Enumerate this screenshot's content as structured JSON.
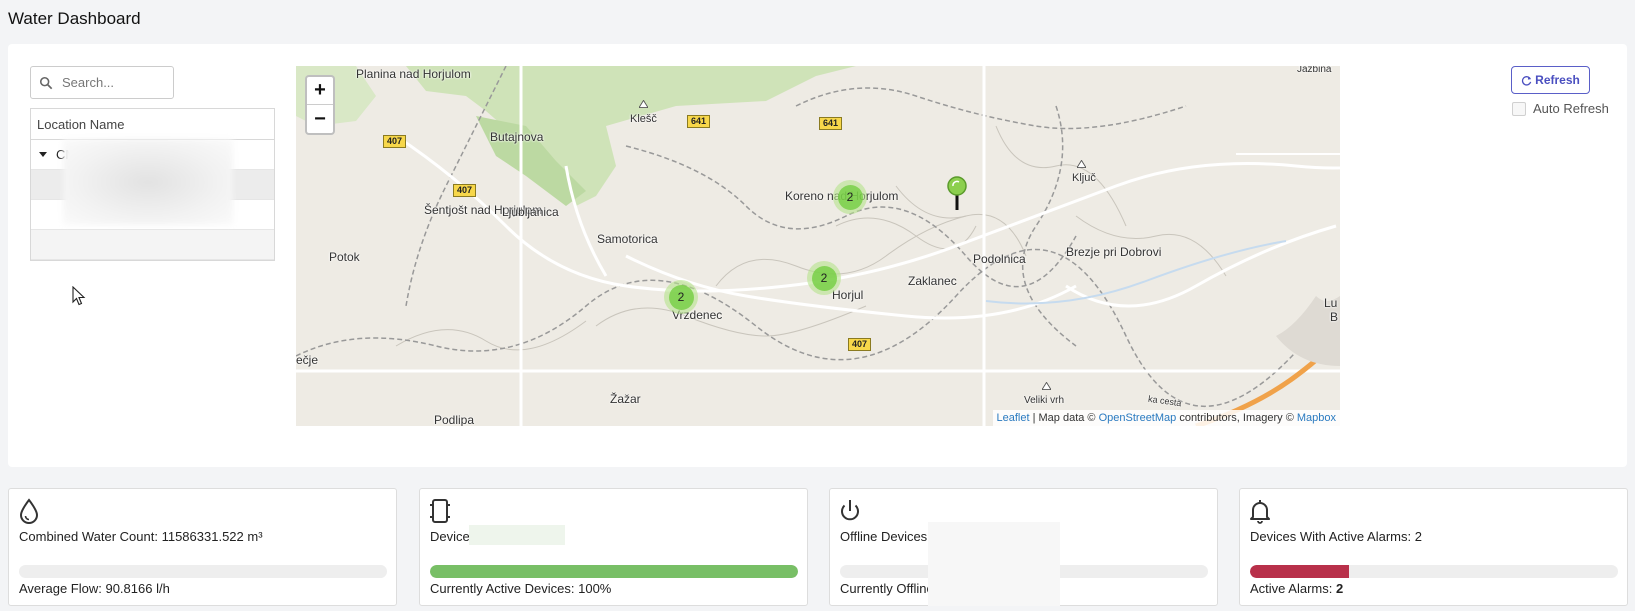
{
  "page": {
    "title": "Water Dashboard"
  },
  "search": {
    "placeholder": "Search..."
  },
  "tree": {
    "header": "Location Name",
    "root": "CMC"
  },
  "map": {
    "zoom_in": "+",
    "zoom_out": "−",
    "attribution": {
      "leaflet": "Leaflet",
      "sep1": " | Map data © ",
      "osm": "OpenStreetMap",
      "mid": " contributors, Imagery © ",
      "mapbox": "Mapbox"
    },
    "clusters": [
      {
        "count": "2"
      },
      {
        "count": "2"
      },
      {
        "count": "2"
      }
    ],
    "places": {
      "planina": "Planina nad Horjulom",
      "butajnova": "Butajnova",
      "klesc": "Klešč",
      "sentjost": "Šentjošt nad Horjulom",
      "ljubljanica": "Ljubljanica",
      "samotorica": "Samotorica",
      "potok": "Potok",
      "koreno": "Koreno nad Horjulom",
      "podolnica": "Podolnica",
      "zaklanec": "Zaklanec",
      "horjul": "Horjul",
      "vrzdenec": "Vrzdenec",
      "zazar": "Žažar",
      "podlipa": "Podlipa",
      "kljuc": "Ključ",
      "brezje": "Brezje pri Dobrovi",
      "veliki": "Veliki vrh",
      "jazbina": "Jazbina",
      "ecje": "ečje",
      "lu": "Lu",
      "b": "B",
      "cesta": "ka cesta"
    },
    "roads": {
      "r407a": "407",
      "r407b": "407",
      "r407c": "407",
      "r641a": "641",
      "r641b": "641"
    }
  },
  "controls": {
    "refresh": "Refresh",
    "auto_refresh": "Auto Refresh"
  },
  "cards": [
    {
      "line1": "Combined Water Count: 11586331.522 m³",
      "line2": "Average Flow: 90.8166 l/h",
      "fill_pct": 0,
      "color": "#eeeeee"
    },
    {
      "line1": "Device",
      "line2": "Currently Active Devices: 100%",
      "fill_pct": 100,
      "color": "#78bf66"
    },
    {
      "line1": "Offline Devices:",
      "line2": "Currently Offline",
      "fill_pct": 0,
      "color": "#eeeeee"
    },
    {
      "line1": "Devices With Active Alarms: 2",
      "line2_prefix": "Active Alarms: ",
      "line2_value": "2",
      "fill_pct": 27,
      "color": "#b8304a"
    }
  ],
  "colors": {
    "accent": "#5a5fc8",
    "cluster": "#6ecc39",
    "active": "#78bf66",
    "alarm": "#b8304a"
  }
}
